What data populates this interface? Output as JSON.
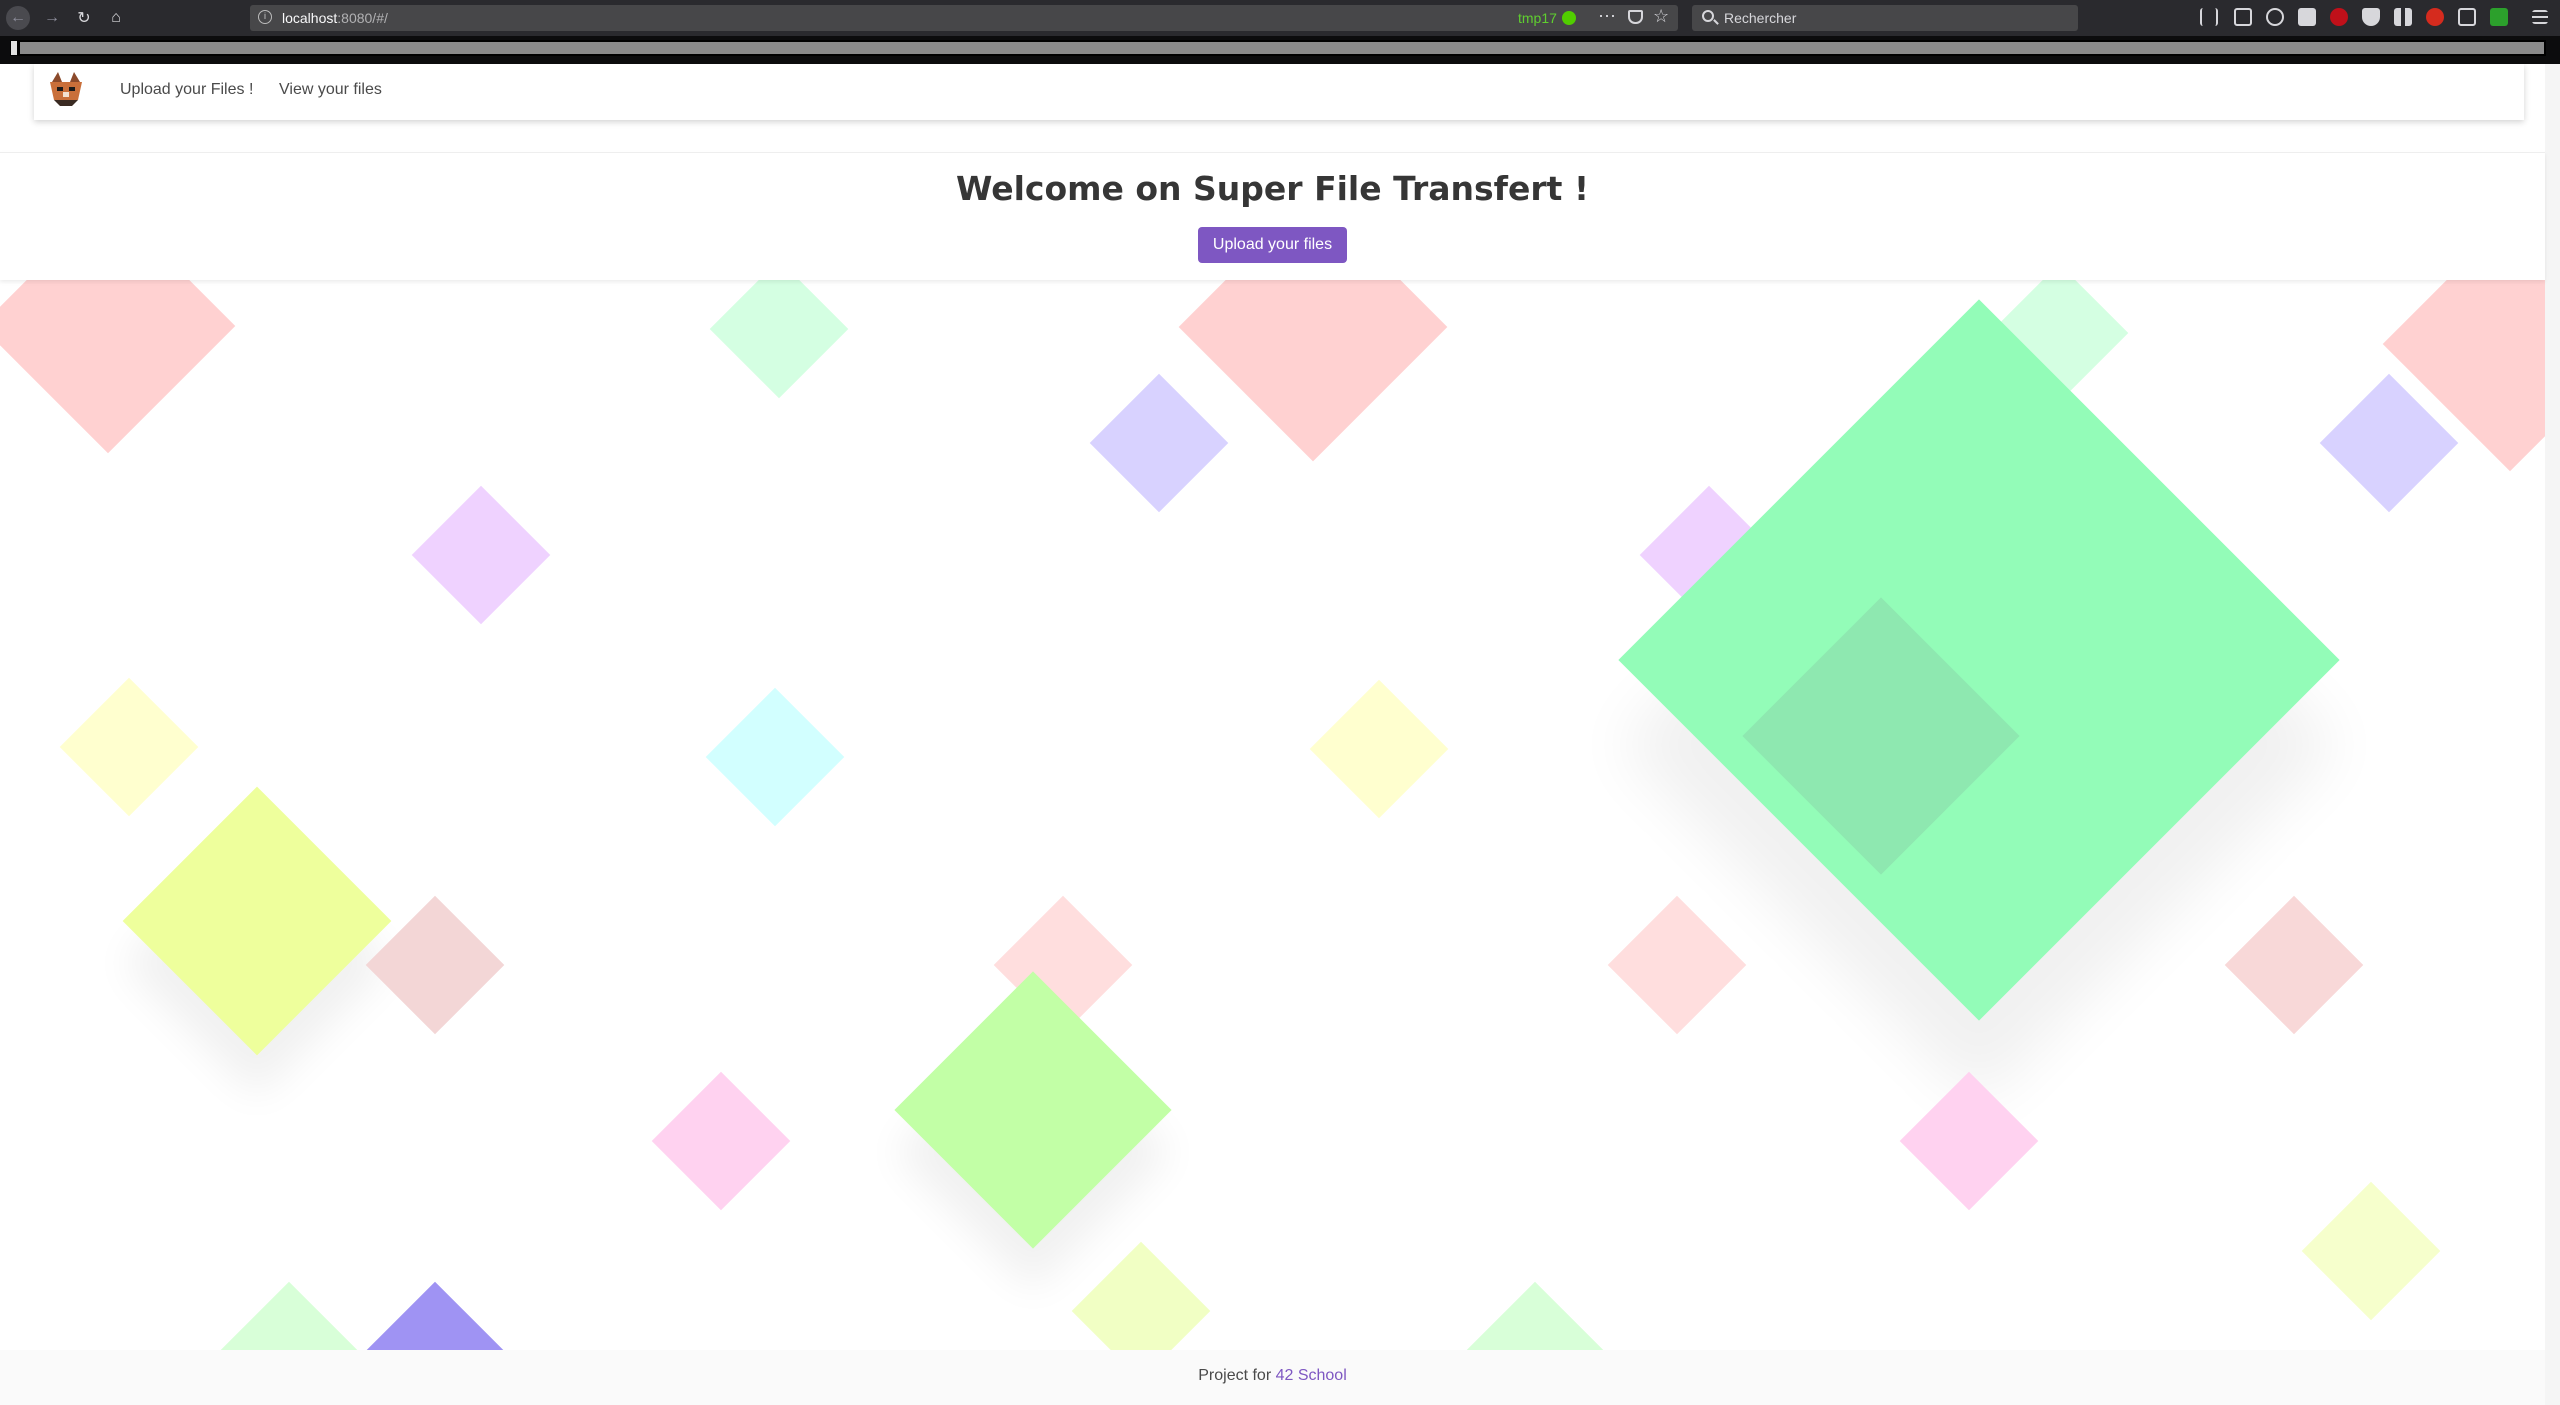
{
  "browser": {
    "url_host": "localhost",
    "url_path": ":8080/#/",
    "container_label": "tmp17",
    "search_placeholder": "Rechercher",
    "icons": {
      "back": "arrow-left-icon",
      "forward": "arrow-right-icon",
      "reload": "reload-icon",
      "home": "home-icon",
      "info": "info-icon",
      "more": "more-dots-icon",
      "pocket": "pocket-icon",
      "bookmark": "star-icon",
      "search": "search-icon",
      "menu": "hamburger-menu-icon"
    }
  },
  "navbar": {
    "logo_icon": "fox-logo-icon",
    "links": [
      "Upload your Files !",
      "View your files"
    ]
  },
  "hero": {
    "title": "Welcome on Super File Transfert !",
    "button_label": "Upload your files",
    "button_color": "#7e57c2"
  },
  "footer": {
    "prefix": "Project for ",
    "link_text": "42 School",
    "link_color": "#7e57c2"
  },
  "background": {
    "pattern": "pastel-rotated-squares",
    "colors": [
      "#ffcccc",
      "#ccffdd",
      "#d4ccff",
      "#eeccff",
      "#ffffcc",
      "#ccffff",
      "#eeff99",
      "#99ff99",
      "#ffccee",
      "#99ffbb",
      "#9999ff"
    ]
  }
}
